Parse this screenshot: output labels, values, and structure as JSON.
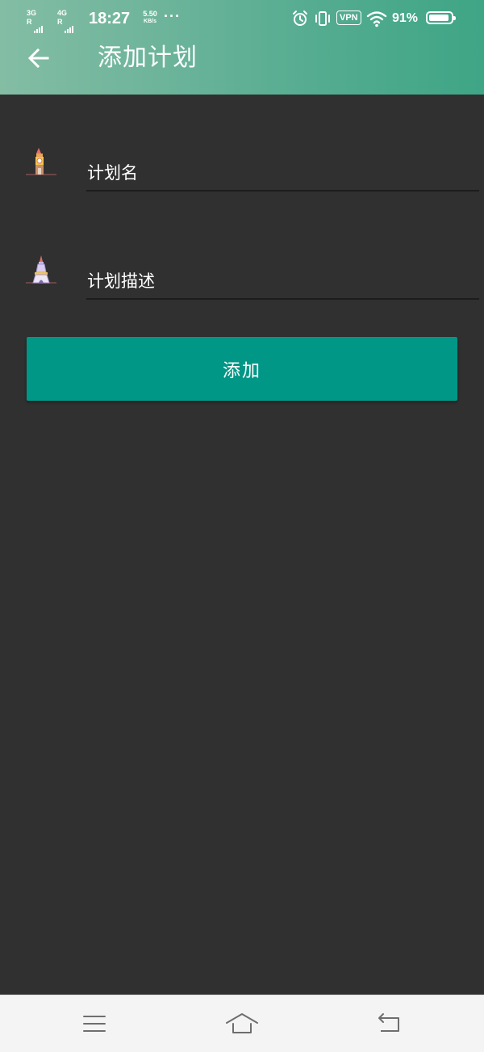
{
  "status_bar": {
    "sim1_gen": "3G",
    "sim1_r": "R",
    "sim2_gen": "4G",
    "sim2_r": "R",
    "time": "18:27",
    "net_speed_value": "5.50",
    "net_speed_unit": "KB/s",
    "more_dots": "···",
    "vpn": "VPN",
    "battery_percent": "91%",
    "battery_level": 0.91
  },
  "header": {
    "back_icon": "arrow-left-icon",
    "title": "添加计划"
  },
  "form": {
    "name_field": {
      "icon": "clock-tower-icon",
      "placeholder": "计划名",
      "value": ""
    },
    "description_field": {
      "icon": "tower-icon",
      "placeholder": "计划描述",
      "value": ""
    },
    "add_button_label": "添加"
  },
  "nav_bar": {
    "menu_icon": "menu-lines-icon",
    "home_icon": "home-icon",
    "back_icon": "back-return-icon"
  },
  "colors": {
    "header_gradient_start": "#83bda4",
    "header_gradient_end": "#3ea585",
    "background": "#303030",
    "button": "#009786",
    "nav_bar": "#f4f4f4"
  }
}
